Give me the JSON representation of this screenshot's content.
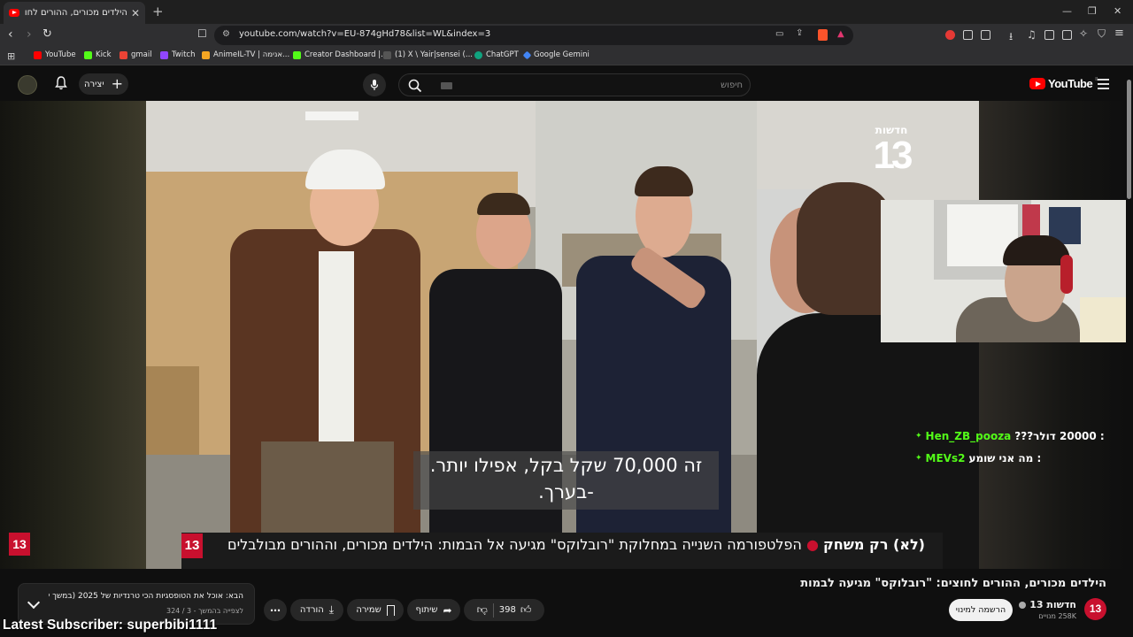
{
  "browser": {
    "tab_title": "הילדים מכורים, ההורים לחוצים: ״",
    "url": "youtube.com/watch?v=EU-874gHd78&list=WL&index=3",
    "bookmarks": [
      {
        "label": "YouTube",
        "color": "#ff0000"
      },
      {
        "label": "Kick",
        "color": "#53fc18"
      },
      {
        "label": "gmail",
        "color": "#ea4335"
      },
      {
        "label": "Twitch",
        "color": "#9146ff"
      },
      {
        "label": "AnimeIL-TV | אנימה...",
        "color": "#f5a623"
      },
      {
        "label": "Creator Dashboard |...",
        "color": "#53fc18"
      },
      {
        "label": "(1) X \\ Yair|sensei (...",
        "color": "#333333"
      },
      {
        "label": "ChatGPT",
        "color": "#10a37f"
      },
      {
        "label": "Google Gemini",
        "color": "#4285f4"
      }
    ]
  },
  "header": {
    "create_label": "יצירה",
    "search_placeholder": "חיפוש",
    "logo_text": "YouTube",
    "logo_region": "IL"
  },
  "video": {
    "subtitle_line1": "זה 70,000 שקל בקל, אפילו יותר.",
    "subtitle_line2": "-בערך.",
    "channel_bug_label": "חדשות",
    "channel_bug_number": "13",
    "ticker_badge": "13",
    "ticker_bold": "(לא) רק משחק",
    "ticker_body": "הפלטפורמה השנייה במחלוקת \"רובלוקס\" מגיעה אל הבמות: הילדים מכורים, וההורים מבולבלים",
    "side_badge": "13"
  },
  "chat": [
    {
      "user": "Hen_ZB_pooza",
      "message": ": 20000 דולר???"
    },
    {
      "user": "MEVs2",
      "message": ": מה אני שומע"
    }
  ],
  "below": {
    "title": "הילדים מכורים, ההורים לחוצים: \"רובלוקס\" מגיעה לבמות",
    "channel_name": "חדשות 13",
    "subscribers": "258K מנויים",
    "subscribe_label": "הרשמה למינוי",
    "likes": "398",
    "share_label": "שיתוף",
    "save_label": "שמירה",
    "download_label": "הורדה",
    "playlist_title": "הבא: אוכל את הטופסגיות הכי טרנדיות של 2025 (במשך יום ...",
    "playlist_sub": "לצפייה בהמשך - 3 / 324"
  },
  "overlay": {
    "latest_subscriber": "Latest Subscriber: superbibi1111"
  }
}
